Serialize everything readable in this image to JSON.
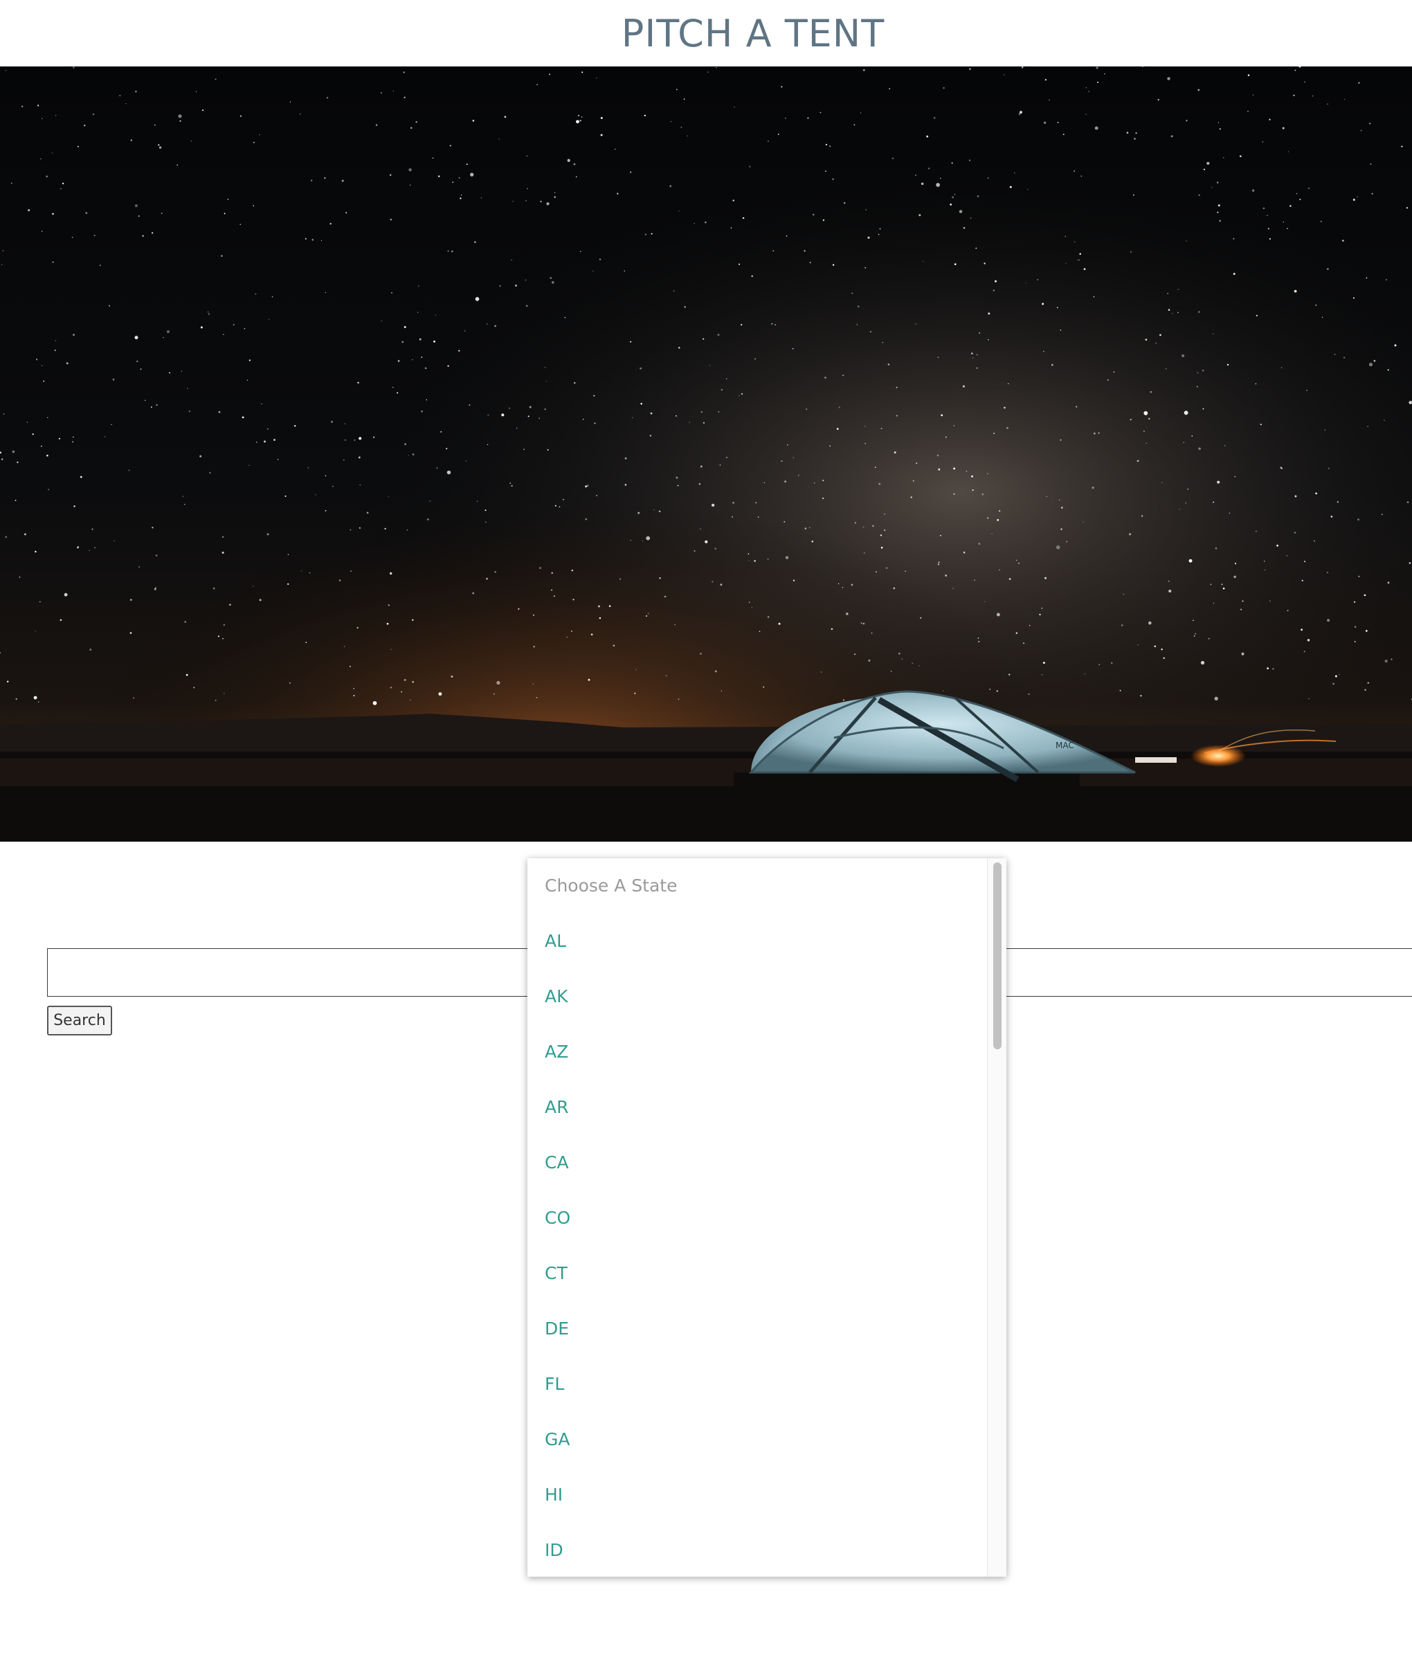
{
  "header": {
    "title": "PITCH A TENT"
  },
  "hero": {
    "image_alt": "Tent under the Milky Way at night beside a campfire",
    "tent_logo_text": "MAC"
  },
  "search": {
    "input_value": "",
    "button_label": "Search"
  },
  "state_select": {
    "placeholder": "Choose A State",
    "options": [
      "AL",
      "AK",
      "AZ",
      "AR",
      "CA",
      "CO",
      "CT",
      "DE",
      "FL",
      "GA",
      "HI",
      "ID"
    ],
    "scroll_position": 0
  },
  "colors": {
    "title": "#5f7584",
    "option_text": "#2f9e8f",
    "placeholder_text": "#9a9a9a"
  }
}
